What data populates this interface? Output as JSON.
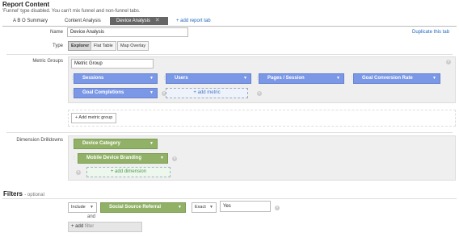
{
  "header": {
    "title": "Report Content",
    "subtitle": "'Funnel' type disabled. You can't mix funnel and non-funnel tabs."
  },
  "tabs": {
    "items": [
      "A B O Summary",
      "Content Analysis",
      "Device Analysis"
    ],
    "add_label": "+ add report tab"
  },
  "name": {
    "label": "Name",
    "value": "Device Analysis",
    "duplicate_label": "Duplicate this tab"
  },
  "type": {
    "label": "Type",
    "options": [
      "Explorer",
      "Flat Table",
      "Map Overlay"
    ],
    "selected": "Explorer"
  },
  "metric_groups": {
    "label": "Metric Groups",
    "group_name": "Metric Group",
    "metrics": [
      "Sessions",
      "Users",
      "Pages / Session",
      "Goal Conversion Rate",
      "Goal Completions"
    ],
    "add_metric_label": "+ add metric",
    "add_group_label": "+ Add metric group"
  },
  "dimensions": {
    "label": "Dimension Drilldowns",
    "items": [
      "Device Category",
      "Mobile Device Branding"
    ],
    "add_dimension_label": "+ add dimension"
  },
  "filters": {
    "title": "Filters",
    "optional": "- optional",
    "include": "Include",
    "dimension": "Social Source Referral",
    "match": "Exact",
    "value": "Yes",
    "and_label": "and",
    "add_filter_prefix": "+ add",
    "add_filter_word": "filter"
  }
}
